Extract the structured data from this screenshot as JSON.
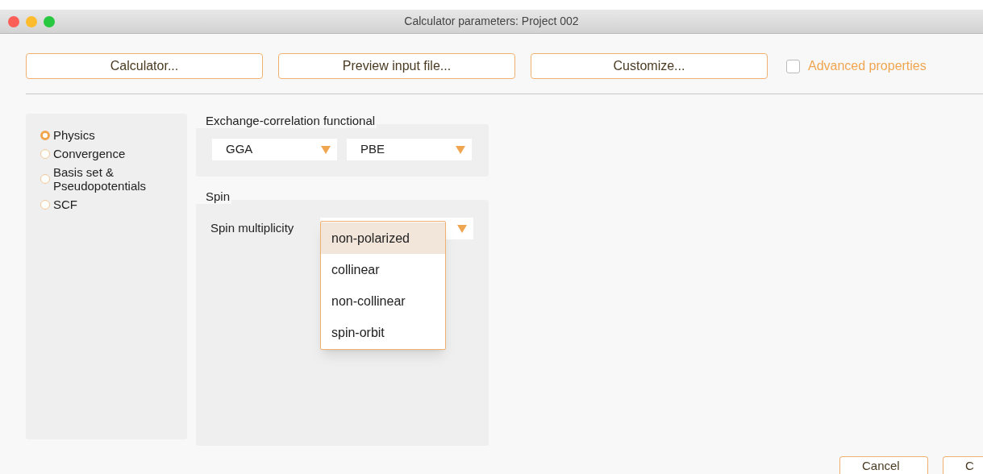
{
  "window": {
    "title": "Calculator parameters: Project 002"
  },
  "toolbar": {
    "buttons": [
      "Calculator...",
      "Preview input file...",
      "Customize..."
    ],
    "advanced_properties": {
      "label": "Advanced properties",
      "checked": false
    }
  },
  "sidebar": {
    "items": [
      {
        "label": "Physics",
        "selected": true
      },
      {
        "label": "Convergence",
        "selected": false
      },
      {
        "label": "Basis set  & Pseudopotentials",
        "selected": false
      },
      {
        "label": "SCF",
        "selected": false
      }
    ]
  },
  "xc_group": {
    "title": "Exchange-correlation functional",
    "selects": [
      "GGA",
      "PBE"
    ]
  },
  "spin_group": {
    "title": "Spin",
    "label": "Spin multiplicity",
    "options": [
      {
        "label": "non-polarized",
        "selected": true
      },
      {
        "label": "collinear",
        "selected": false
      },
      {
        "label": "non-collinear",
        "selected": false
      },
      {
        "label": "spin-orbit",
        "selected": false
      }
    ]
  },
  "footer": {
    "buttons": [
      "Cancel",
      "C"
    ]
  }
}
